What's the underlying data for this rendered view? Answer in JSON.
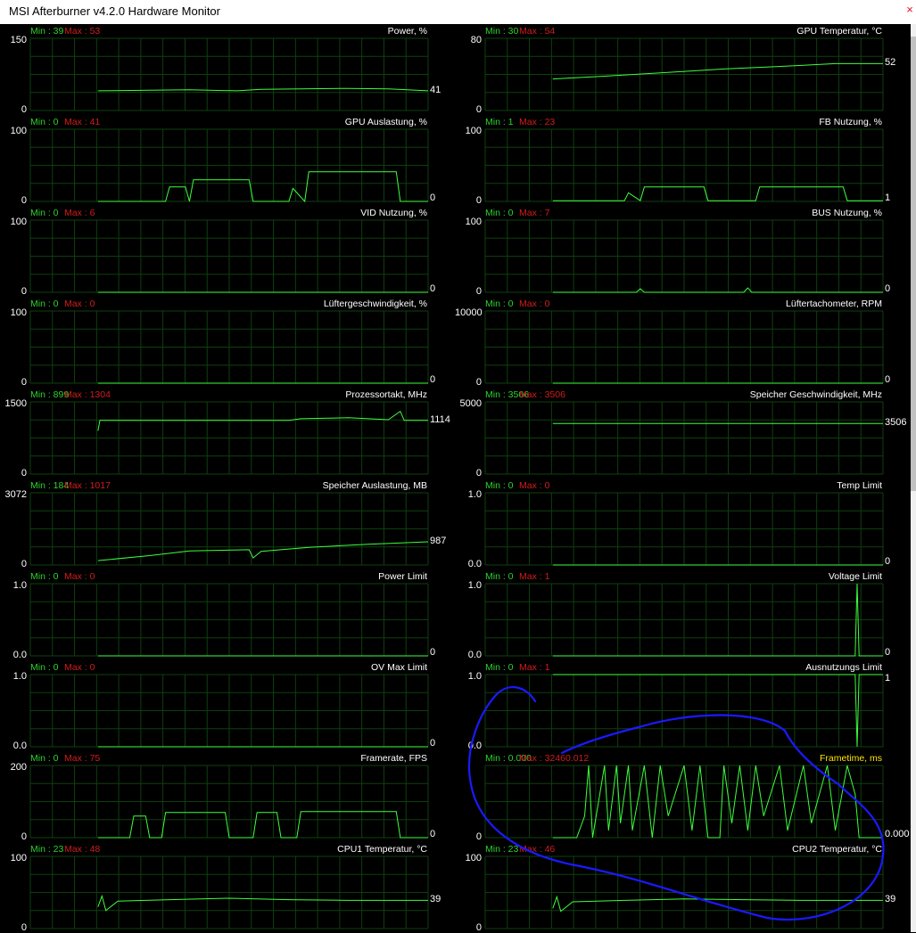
{
  "window": {
    "title": "MSI Afterburner v4.2.0 Hardware Monitor",
    "close_glyph": "×"
  },
  "colors": {
    "grid": "#0f3f0f",
    "trace": "#3dff3d",
    "min_text": "#2fd12f",
    "max_text": "#d21c1c",
    "highlight_text": "#ffe400"
  },
  "graphs": [
    {
      "name": "Power, %",
      "min": "Min : 39",
      "max": "Max : 53",
      "ytop": "150",
      "ybot": "0",
      "current": "41",
      "ymax": 150,
      "trace": [
        [
          0.17,
          41
        ],
        [
          0.3,
          42
        ],
        [
          0.4,
          43
        ],
        [
          0.45,
          42
        ],
        [
          0.52,
          41
        ],
        [
          0.58,
          44
        ],
        [
          0.68,
          45
        ],
        [
          0.8,
          46
        ],
        [
          0.9,
          45
        ],
        [
          1.0,
          41
        ]
      ]
    },
    {
      "name": "GPU Temperatur, °C",
      "min": "Min : 30",
      "max": "Max : 54",
      "ytop": "80",
      "ybot": "0",
      "current": "52",
      "ymax": 80,
      "trace": [
        [
          0.17,
          35
        ],
        [
          0.3,
          38
        ],
        [
          0.45,
          42
        ],
        [
          0.6,
          46
        ],
        [
          0.75,
          49
        ],
        [
          0.88,
          52
        ],
        [
          1.0,
          52
        ]
      ]
    },
    {
      "name": "GPU Auslastung, %",
      "min": "Min : 0",
      "max": "Max : 41",
      "ytop": "100",
      "ybot": "0",
      "current": "0",
      "ymax": 100,
      "trace": [
        [
          0.17,
          0
        ],
        [
          0.34,
          0
        ],
        [
          0.35,
          20
        ],
        [
          0.39,
          20
        ],
        [
          0.4,
          0
        ],
        [
          0.41,
          30
        ],
        [
          0.55,
          30
        ],
        [
          0.56,
          0
        ],
        [
          0.65,
          0
        ],
        [
          0.66,
          18
        ],
        [
          0.69,
          0
        ],
        [
          0.7,
          41
        ],
        [
          0.92,
          41
        ],
        [
          0.93,
          0
        ],
        [
          1.0,
          0
        ]
      ]
    },
    {
      "name": "FB Nutzung, %",
      "min": "Min : 1",
      "max": "Max : 23",
      "ytop": "100",
      "ybot": "0",
      "current": "1",
      "ymax": 100,
      "trace": [
        [
          0.17,
          1
        ],
        [
          0.35,
          1
        ],
        [
          0.36,
          12
        ],
        [
          0.39,
          1
        ],
        [
          0.4,
          20
        ],
        [
          0.55,
          20
        ],
        [
          0.56,
          1
        ],
        [
          0.68,
          1
        ],
        [
          0.69,
          20
        ],
        [
          0.9,
          20
        ],
        [
          0.91,
          1
        ],
        [
          1.0,
          1
        ]
      ]
    },
    {
      "name": "VID Nutzung, %",
      "min": "Min : 0",
      "max": "Max : 6",
      "ytop": "100",
      "ybot": "0",
      "current": "0",
      "ymax": 100,
      "trace": [
        [
          0.17,
          0
        ],
        [
          1.0,
          0
        ]
      ]
    },
    {
      "name": "BUS Nutzung, %",
      "min": "Min : 0",
      "max": "Max : 7",
      "ytop": "100",
      "ybot": "0",
      "current": "0",
      "ymax": 100,
      "trace": [
        [
          0.17,
          0
        ],
        [
          0.38,
          0
        ],
        [
          0.39,
          5
        ],
        [
          0.4,
          0
        ],
        [
          0.65,
          0
        ],
        [
          0.66,
          6
        ],
        [
          0.67,
          0
        ],
        [
          1.0,
          0
        ]
      ]
    },
    {
      "name": "Lüftergeschwindigkeit, %",
      "min": "Min : 0",
      "max": "Max : 0",
      "ytop": "100",
      "ybot": "0",
      "current": "0",
      "ymax": 100,
      "trace": [
        [
          0.17,
          0
        ],
        [
          1.0,
          0
        ]
      ]
    },
    {
      "name": "Lüftertachometer, RPM",
      "min": "Min : 0",
      "max": "Max : 0",
      "ytop": "10000",
      "ybot": "0",
      "current": "0",
      "ymax": 10000,
      "trace": [
        [
          0.17,
          0
        ],
        [
          1.0,
          0
        ]
      ]
    },
    {
      "name": "Prozessortakt, MHz",
      "min": "Min : 899",
      "max": "Max : 1304",
      "ytop": "1500",
      "ybot": "0",
      "current": "1114",
      "ymax": 1500,
      "trace": [
        [
          0.17,
          899
        ],
        [
          0.175,
          1114
        ],
        [
          0.65,
          1114
        ],
        [
          0.68,
          1150
        ],
        [
          0.8,
          1170
        ],
        [
          0.9,
          1130
        ],
        [
          0.93,
          1304
        ],
        [
          0.94,
          1114
        ],
        [
          1.0,
          1114
        ]
      ]
    },
    {
      "name": "Speicher Geschwindigkeit, MHz",
      "min": "Min : 3506",
      "max": "Max : 3506",
      "ytop": "5000",
      "ybot": "0",
      "current": "3506",
      "ymax": 5000,
      "trace": [
        [
          0.17,
          3506
        ],
        [
          1.0,
          3506
        ]
      ]
    },
    {
      "name": "Speicher Auslastung, MB",
      "min": "Min : 184",
      "max": "Max : 1017",
      "ytop": "3072",
      "ybot": "0",
      "current": "987",
      "ymax": 3072,
      "trace": [
        [
          0.17,
          184
        ],
        [
          0.3,
          400
        ],
        [
          0.4,
          600
        ],
        [
          0.55,
          650
        ],
        [
          0.56,
          300
        ],
        [
          0.58,
          580
        ],
        [
          0.7,
          750
        ],
        [
          0.85,
          880
        ],
        [
          1.0,
          987
        ]
      ]
    },
    {
      "name": "Temp Limit",
      "min": "Min : 0",
      "max": "Max : 0",
      "ytop": "1.0",
      "ybot": "0.0",
      "current": "0",
      "ymax": 1,
      "trace": [
        [
          0.17,
          0
        ],
        [
          1.0,
          0
        ]
      ]
    },
    {
      "name": "Power Limit",
      "min": "Min : 0",
      "max": "Max : 0",
      "ytop": "1.0",
      "ybot": "0.0",
      "current": "0",
      "ymax": 1,
      "trace": [
        [
          0.17,
          0
        ],
        [
          1.0,
          0
        ]
      ]
    },
    {
      "name": "Voltage Limit",
      "min": "Min : 0",
      "max": "Max : 1",
      "ytop": "1.0",
      "ybot": "0.0",
      "current": "0",
      "ymax": 1,
      "trace": [
        [
          0.17,
          0
        ],
        [
          0.93,
          0
        ],
        [
          0.935,
          1
        ],
        [
          0.94,
          0
        ],
        [
          1.0,
          0
        ]
      ]
    },
    {
      "name": "OV Max Limit",
      "min": "Min : 0",
      "max": "Max : 0",
      "ytop": "1.0",
      "ybot": "0.0",
      "current": "0",
      "ymax": 1,
      "trace": [
        [
          0.17,
          0
        ],
        [
          1.0,
          0
        ]
      ]
    },
    {
      "name": "Ausnutzungs Limit",
      "min": "Min : 0",
      "max": "Max : 1",
      "ytop": "1.0",
      "ybot": "0.0",
      "current": "1",
      "ymax": 1,
      "trace": [
        [
          0.17,
          1
        ],
        [
          0.93,
          1
        ],
        [
          0.935,
          0
        ],
        [
          0.94,
          1
        ],
        [
          1.0,
          1
        ]
      ]
    },
    {
      "name": "Framerate, FPS",
      "min": "Min : 0",
      "max": "Max : 75",
      "ytop": "200",
      "ybot": "0",
      "current": "0",
      "ymax": 200,
      "trace": [
        [
          0.17,
          0
        ],
        [
          0.25,
          0
        ],
        [
          0.26,
          60
        ],
        [
          0.29,
          60
        ],
        [
          0.3,
          0
        ],
        [
          0.33,
          0
        ],
        [
          0.34,
          70
        ],
        [
          0.49,
          70
        ],
        [
          0.5,
          0
        ],
        [
          0.56,
          0
        ],
        [
          0.57,
          70
        ],
        [
          0.62,
          70
        ],
        [
          0.63,
          0
        ],
        [
          0.67,
          0
        ],
        [
          0.68,
          72
        ],
        [
          0.92,
          72
        ],
        [
          0.93,
          0
        ],
        [
          1.0,
          0
        ]
      ]
    },
    {
      "name": "Frametime, ms",
      "min": "Min : 0.000",
      "max": "Max : 32460.012",
      "ytop": "",
      "ybot": "0",
      "current": "0.000",
      "ymax": 100,
      "highlight": true,
      "trace": [
        [
          0.17,
          0
        ],
        [
          0.23,
          0
        ],
        [
          0.25,
          30
        ],
        [
          0.26,
          100
        ],
        [
          0.27,
          0
        ],
        [
          0.3,
          100
        ],
        [
          0.31,
          10
        ],
        [
          0.33,
          100
        ],
        [
          0.34,
          20
        ],
        [
          0.36,
          100
        ],
        [
          0.37,
          10
        ],
        [
          0.4,
          100
        ],
        [
          0.42,
          0
        ],
        [
          0.44,
          100
        ],
        [
          0.46,
          30
        ],
        [
          0.5,
          100
        ],
        [
          0.52,
          10
        ],
        [
          0.54,
          100
        ],
        [
          0.56,
          0
        ],
        [
          0.59,
          0
        ],
        [
          0.6,
          100
        ],
        [
          0.62,
          20
        ],
        [
          0.64,
          100
        ],
        [
          0.66,
          10
        ],
        [
          0.68,
          100
        ],
        [
          0.7,
          30
        ],
        [
          0.74,
          100
        ],
        [
          0.76,
          10
        ],
        [
          0.8,
          100
        ],
        [
          0.82,
          20
        ],
        [
          0.86,
          100
        ],
        [
          0.88,
          10
        ],
        [
          0.91,
          100
        ],
        [
          0.93,
          60
        ],
        [
          0.94,
          0
        ],
        [
          1.0,
          0
        ]
      ]
    },
    {
      "name": "CPU1 Temperatur, °C",
      "min": "Min : 23",
      "max": "Max : 48",
      "ytop": "100",
      "ybot": "0",
      "current": "39",
      "ymax": 100,
      "trace": [
        [
          0.17,
          30
        ],
        [
          0.18,
          45
        ],
        [
          0.19,
          25
        ],
        [
          0.22,
          38
        ],
        [
          0.35,
          40
        ],
        [
          0.5,
          42
        ],
        [
          0.65,
          40
        ],
        [
          0.8,
          39
        ],
        [
          1.0,
          39
        ]
      ]
    },
    {
      "name": "CPU2 Temperatur, °C",
      "min": "Min : 23",
      "max": "Max : 46",
      "ytop": "100",
      "ybot": "0",
      "current": "39",
      "ymax": 100,
      "trace": [
        [
          0.17,
          28
        ],
        [
          0.18,
          44
        ],
        [
          0.19,
          24
        ],
        [
          0.22,
          37
        ],
        [
          0.35,
          39
        ],
        [
          0.5,
          41
        ],
        [
          0.65,
          40
        ],
        [
          0.8,
          39
        ],
        [
          1.0,
          39
        ]
      ]
    }
  ]
}
